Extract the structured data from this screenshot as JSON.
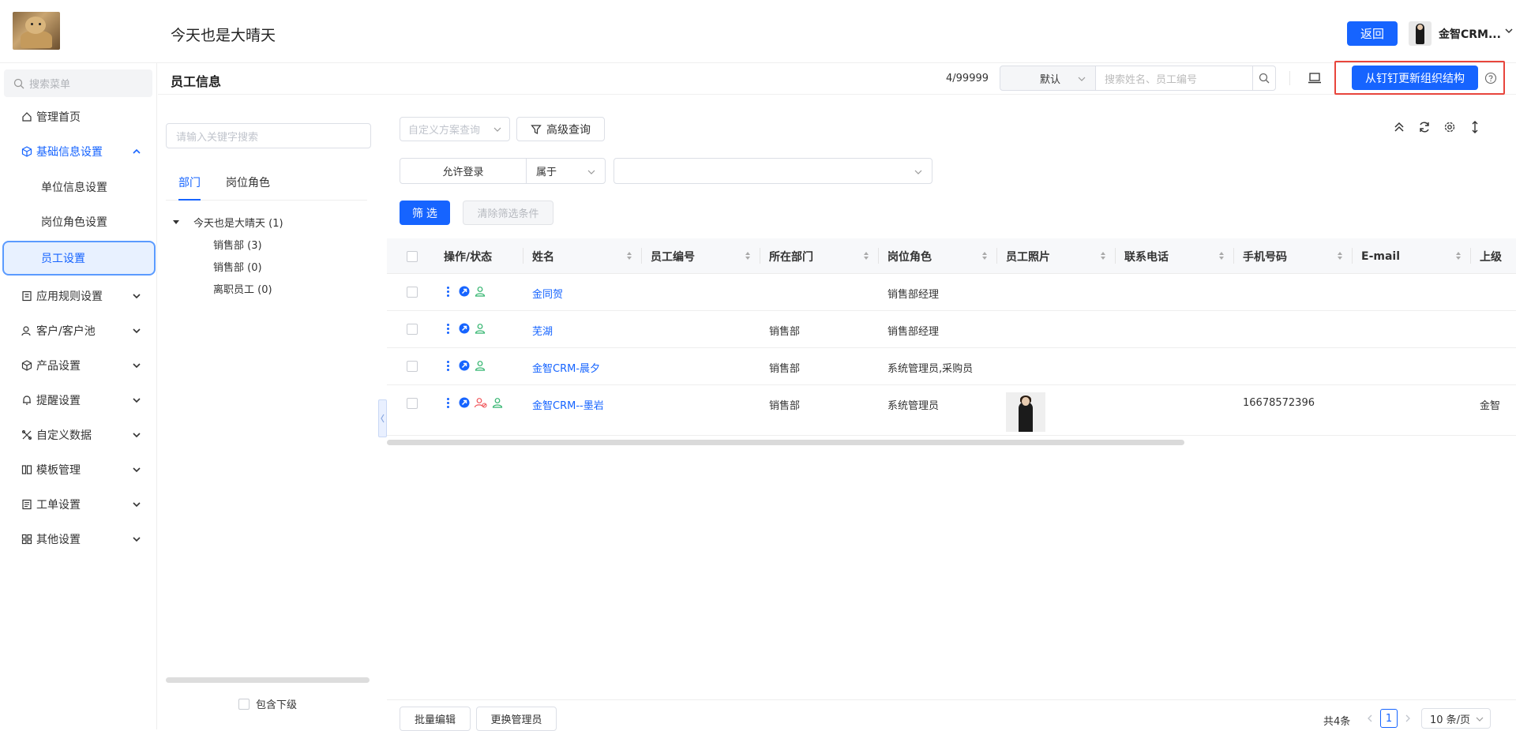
{
  "header": {
    "app_title": "今天也是大晴天",
    "back_label": "返回",
    "user_name": "金智CRM..."
  },
  "sidebar": {
    "search_placeholder": "搜索菜单",
    "items": [
      {
        "label": "管理首页",
        "icon": "home-icon"
      },
      {
        "label": "基础信息设置",
        "icon": "cube-icon",
        "expanded": true
      },
      {
        "label": "单位信息设置",
        "sub": true
      },
      {
        "label": "岗位角色设置",
        "sub": true
      },
      {
        "label": "员工设置",
        "sub": true,
        "selected": true
      },
      {
        "label": "应用规则设置",
        "icon": "rules-icon"
      },
      {
        "label": "客户/客户池",
        "icon": "customer-icon"
      },
      {
        "label": "产品设置",
        "icon": "product-icon"
      },
      {
        "label": "提醒设置",
        "icon": "bell-icon"
      },
      {
        "label": "自定义数据",
        "icon": "custom-data-icon"
      },
      {
        "label": "模板管理",
        "icon": "template-icon"
      },
      {
        "label": "工单设置",
        "icon": "ticket-icon"
      },
      {
        "label": "其他设置",
        "icon": "other-icon"
      }
    ]
  },
  "content_header": {
    "title": "员工信息",
    "count": "4/99999",
    "select_value": "默认",
    "search_placeholder": "搜索姓名、员工编号",
    "sync_label": "从钉钉更新组织结构"
  },
  "tree": {
    "search_placeholder": "请输入关键字搜索",
    "tabs": [
      "部门",
      "岗位角色"
    ],
    "nodes": [
      {
        "label": "今天也是大晴天 (1)",
        "level": 0
      },
      {
        "label": "销售部 (3)",
        "level": 1
      },
      {
        "label": "销售部 (0)",
        "level": 1
      },
      {
        "label": "离职员工 (0)",
        "level": 1
      }
    ],
    "footer_label": "包含下级"
  },
  "filters": {
    "scheme_placeholder": "自定义方案查询",
    "advanced_label": "高级查询",
    "field_label": "允许登录",
    "operator_label": "属于",
    "filter_btn": "筛 选",
    "clear_btn": "清除筛选条件"
  },
  "table": {
    "columns": [
      "操作/状态",
      "姓名",
      "员工编号",
      "所在部门",
      "岗位角色",
      "员工照片",
      "联系电话",
      "手机号码",
      "E-mail",
      "上级"
    ],
    "rows": [
      {
        "name": "金同贺",
        "emp_no": "",
        "dept": "",
        "role": "销售部经理",
        "phone": "",
        "mobile": "",
        "email": "",
        "superior": ""
      },
      {
        "name": "芜湖",
        "emp_no": "",
        "dept": "销售部",
        "role": "销售部经理",
        "phone": "",
        "mobile": "",
        "email": "",
        "superior": ""
      },
      {
        "name": "金智CRM-晨夕",
        "emp_no": "",
        "dept": "销售部",
        "role": "系统管理员,采购员",
        "phone": "",
        "mobile": "",
        "email": "",
        "superior": ""
      },
      {
        "name": "金智CRM--墨岩",
        "emp_no": "",
        "dept": "销售部",
        "role": "系统管理员",
        "phone": "",
        "mobile": "16678572396",
        "email": "",
        "superior": "金智"
      }
    ]
  },
  "bottom": {
    "batch_edit": "批量编辑",
    "change_admin": "更换管理员",
    "total": "共4条",
    "current_page": "1",
    "page_size": "10 条/页"
  },
  "colors": {
    "primary": "#1664ff",
    "highlight_frame": "#e8453c"
  }
}
